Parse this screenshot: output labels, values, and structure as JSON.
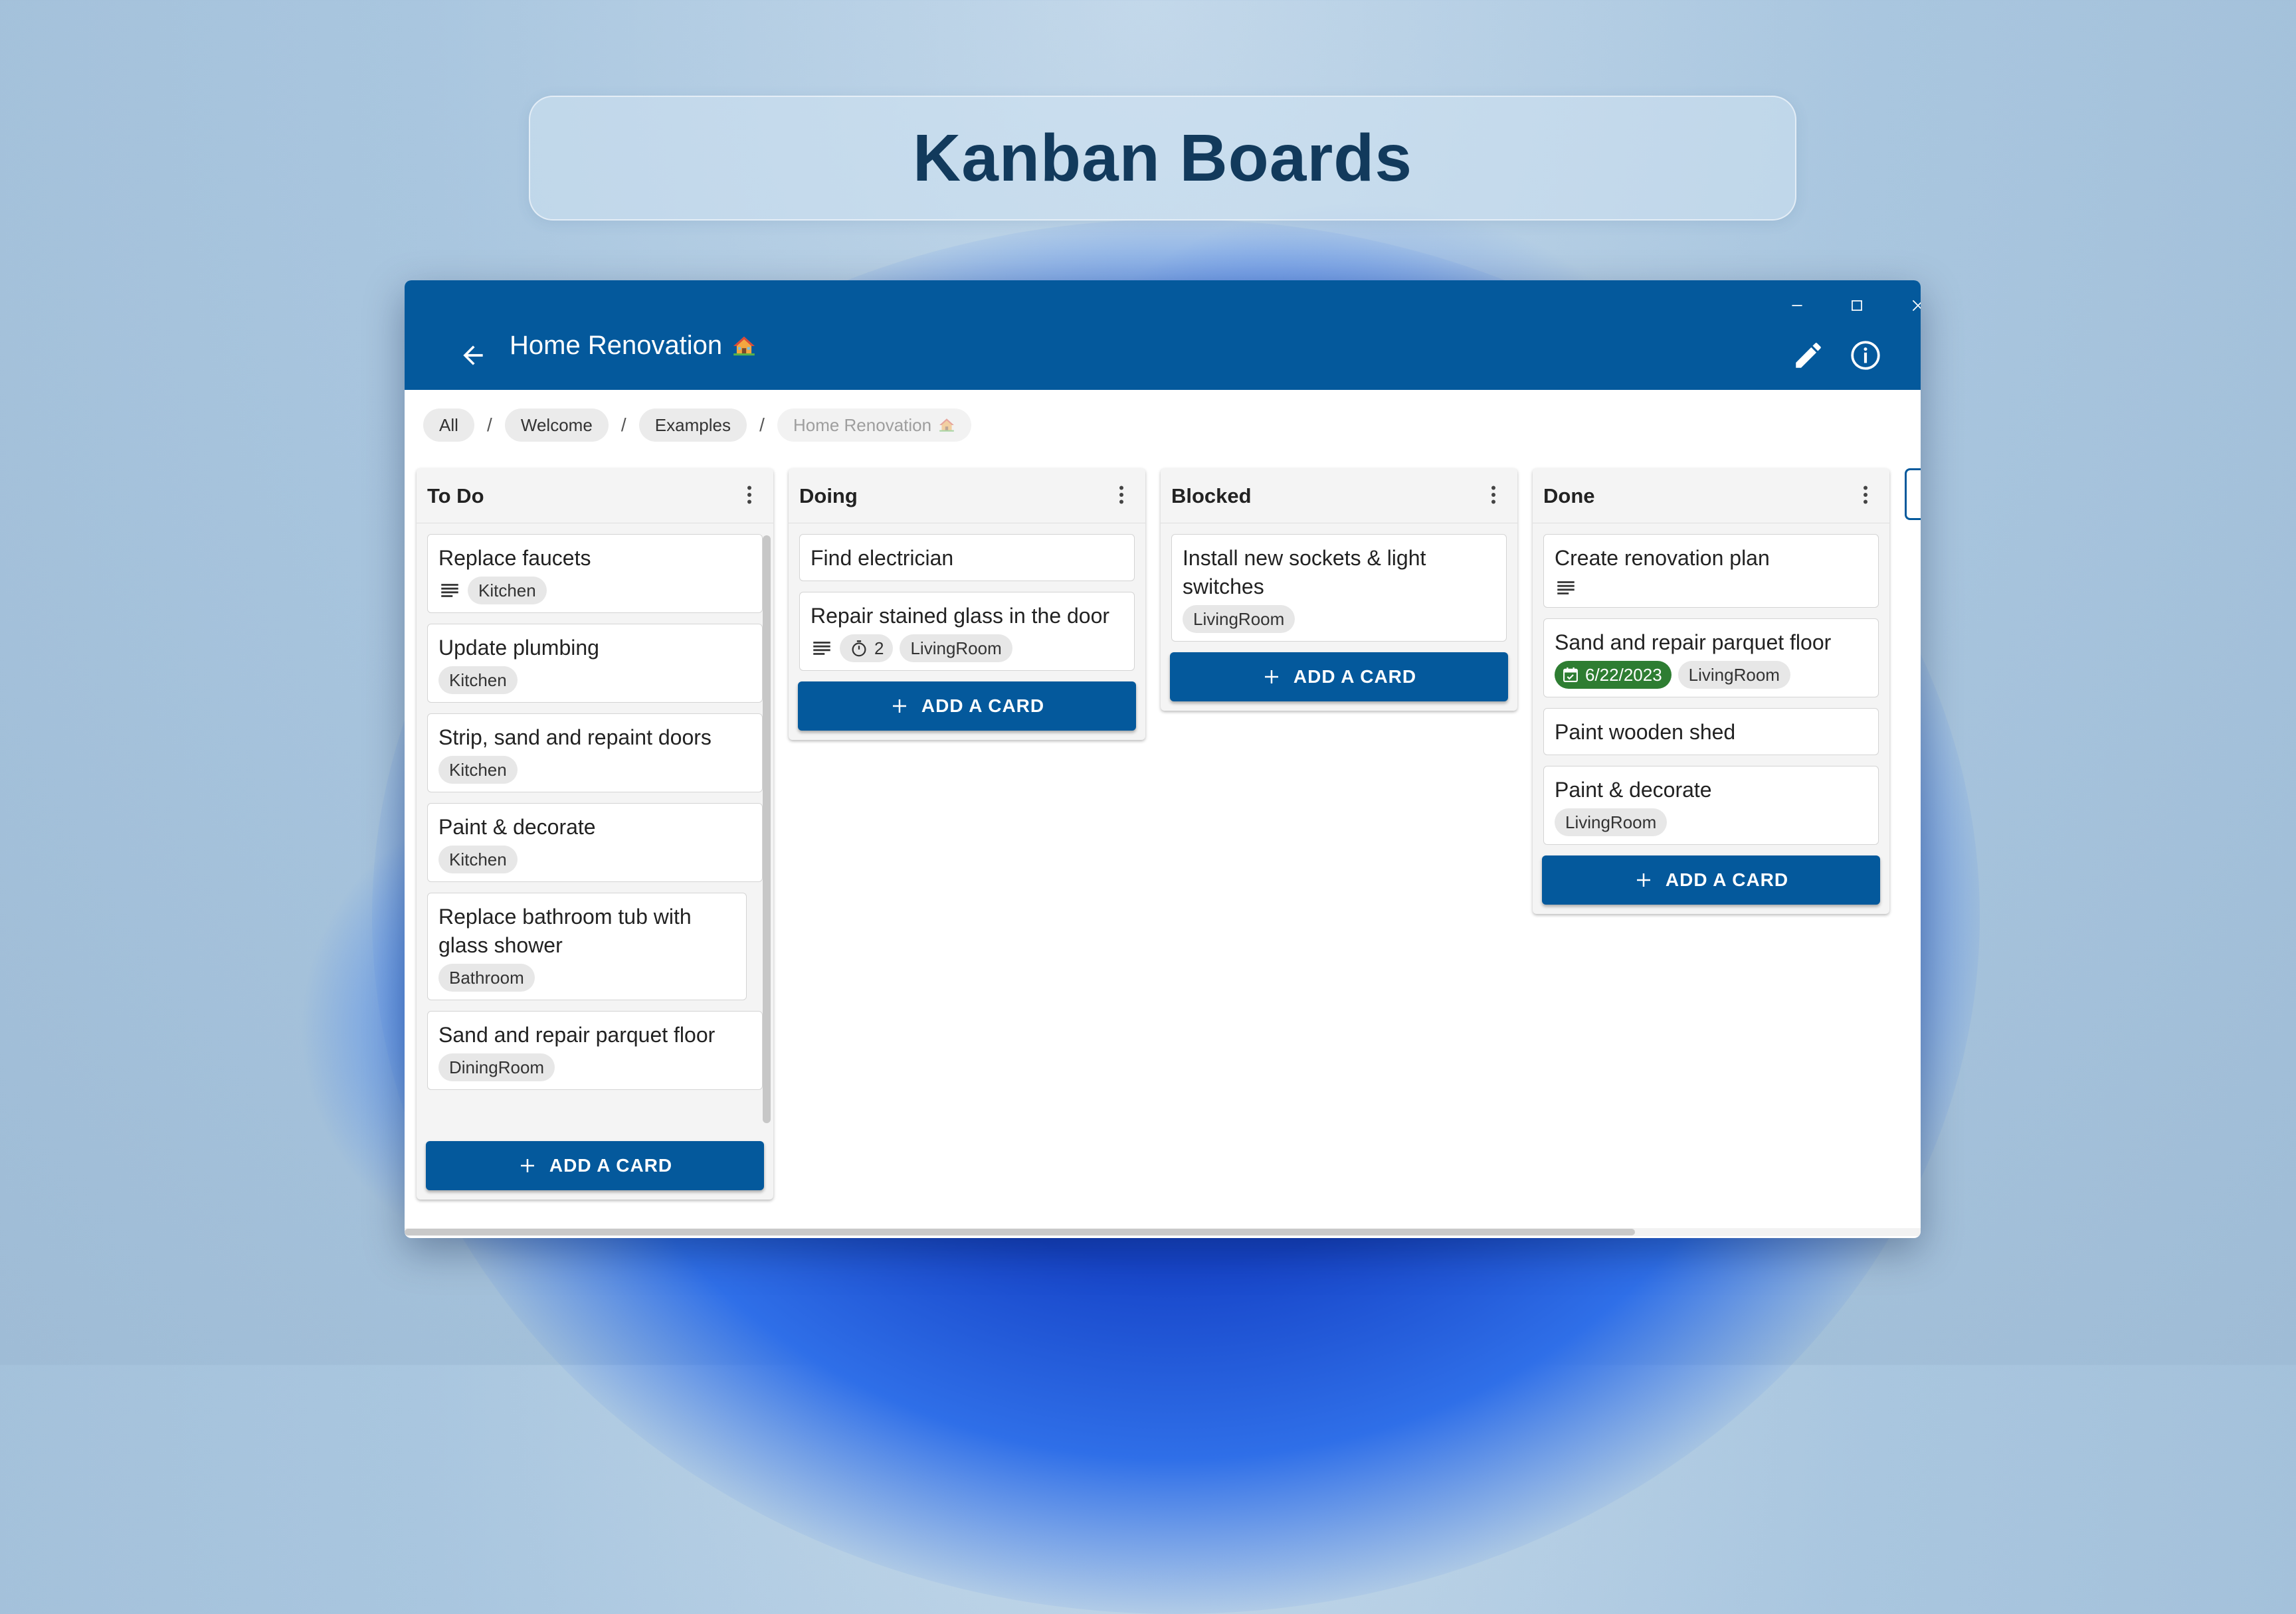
{
  "banner": {
    "title": "Kanban Boards"
  },
  "window": {
    "controls": {
      "minimize_icon": "minimize-icon",
      "maximize_icon": "maximize-icon",
      "close_icon": "close-icon"
    }
  },
  "appbar": {
    "title": "Home Renovation",
    "title_icon": "house-emoji-icon",
    "actions": [
      "pencil-icon",
      "info-icon"
    ],
    "background": "#04599c"
  },
  "breadcrumb": {
    "items": [
      "All",
      "Welcome",
      "Examples"
    ],
    "current": "Home Renovation",
    "separator": "/"
  },
  "add_card_label": "ADD A CARD",
  "columns": [
    {
      "title": "To Do",
      "cards": [
        {
          "title": "Replace faucets",
          "description_icon": true,
          "tags": [
            "Kitchen"
          ]
        },
        {
          "title": "Update plumbing",
          "tags": [
            "Kitchen"
          ]
        },
        {
          "title": "Strip, sand and repaint doors",
          "tags": [
            "Kitchen"
          ]
        },
        {
          "title": "Paint & decorate",
          "tags": [
            "Kitchen"
          ]
        },
        {
          "title": "Replace bathroom tub with glass shower",
          "tags": [
            "Bathroom"
          ]
        },
        {
          "title": "Sand and repair parquet floor",
          "tags": [
            "DiningRoom"
          ]
        }
      ]
    },
    {
      "title": "Doing",
      "cards": [
        {
          "title": "Find electrician"
        },
        {
          "title": "Repair stained glass in the door",
          "description_icon": true,
          "timer": "2",
          "tags": [
            "LivingRoom"
          ]
        }
      ]
    },
    {
      "title": "Blocked",
      "cards": [
        {
          "title": "Install new sockets & light switches",
          "tags": [
            "LivingRoom"
          ]
        }
      ]
    },
    {
      "title": "Done",
      "cards": [
        {
          "title": "Create renovation plan",
          "description_icon": true
        },
        {
          "title": "Sand and repair parquet floor",
          "due_date": "6/22/2023",
          "tags": [
            "LivingRoom"
          ]
        },
        {
          "title": "Paint wooden shed"
        },
        {
          "title": "Paint & decorate",
          "tags": [
            "LivingRoom"
          ]
        }
      ]
    }
  ],
  "colors": {
    "primary": "#04599c",
    "due_date": "#2e7d32",
    "tag_bg": "#e7e7e7"
  }
}
